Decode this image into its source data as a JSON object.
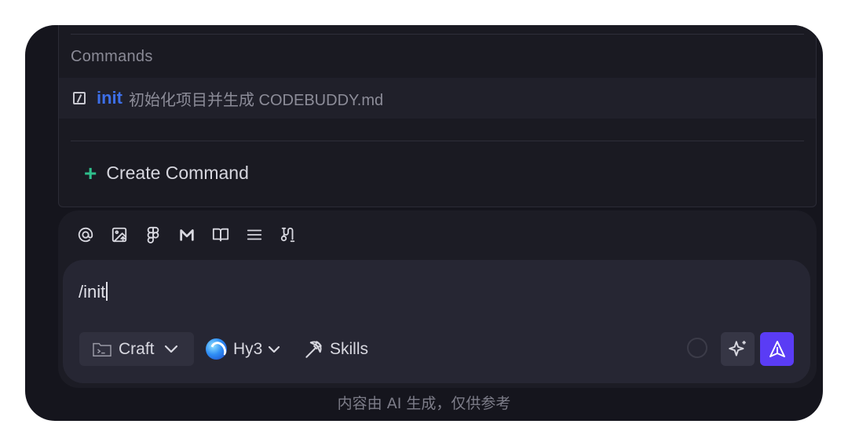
{
  "popup": {
    "section_title": "Commands",
    "command": {
      "name": "init",
      "description": "初始化项目并生成 CODEBUDDY.md",
      "icon": "slash-square-icon"
    },
    "create": {
      "icon": "plus-icon",
      "label": "Create Command"
    }
  },
  "toolbar": {
    "icons": [
      "at-mention-icon",
      "image-upload-icon",
      "figma-icon",
      "m-logo-icon",
      "book-icon",
      "list-icon",
      "workflow-icon"
    ]
  },
  "input": {
    "value": "/init"
  },
  "controls": {
    "mode": {
      "icon": "terminal-folder-icon",
      "label": "Craft"
    },
    "model": {
      "icon": "hy-model-logo",
      "label": "Hy3"
    },
    "skills": {
      "icon": "pickaxe-icon",
      "label": "Skills"
    },
    "enhance_icon": "sparkles-icon",
    "send_icon": "send-arrow-icon"
  },
  "footer": {
    "disclaimer": "内容由 AI 生成，仅供参考"
  },
  "colors": {
    "accent": "#5a3cf5",
    "command_name": "#3d6fe8",
    "plus": "#2fbf8c"
  }
}
